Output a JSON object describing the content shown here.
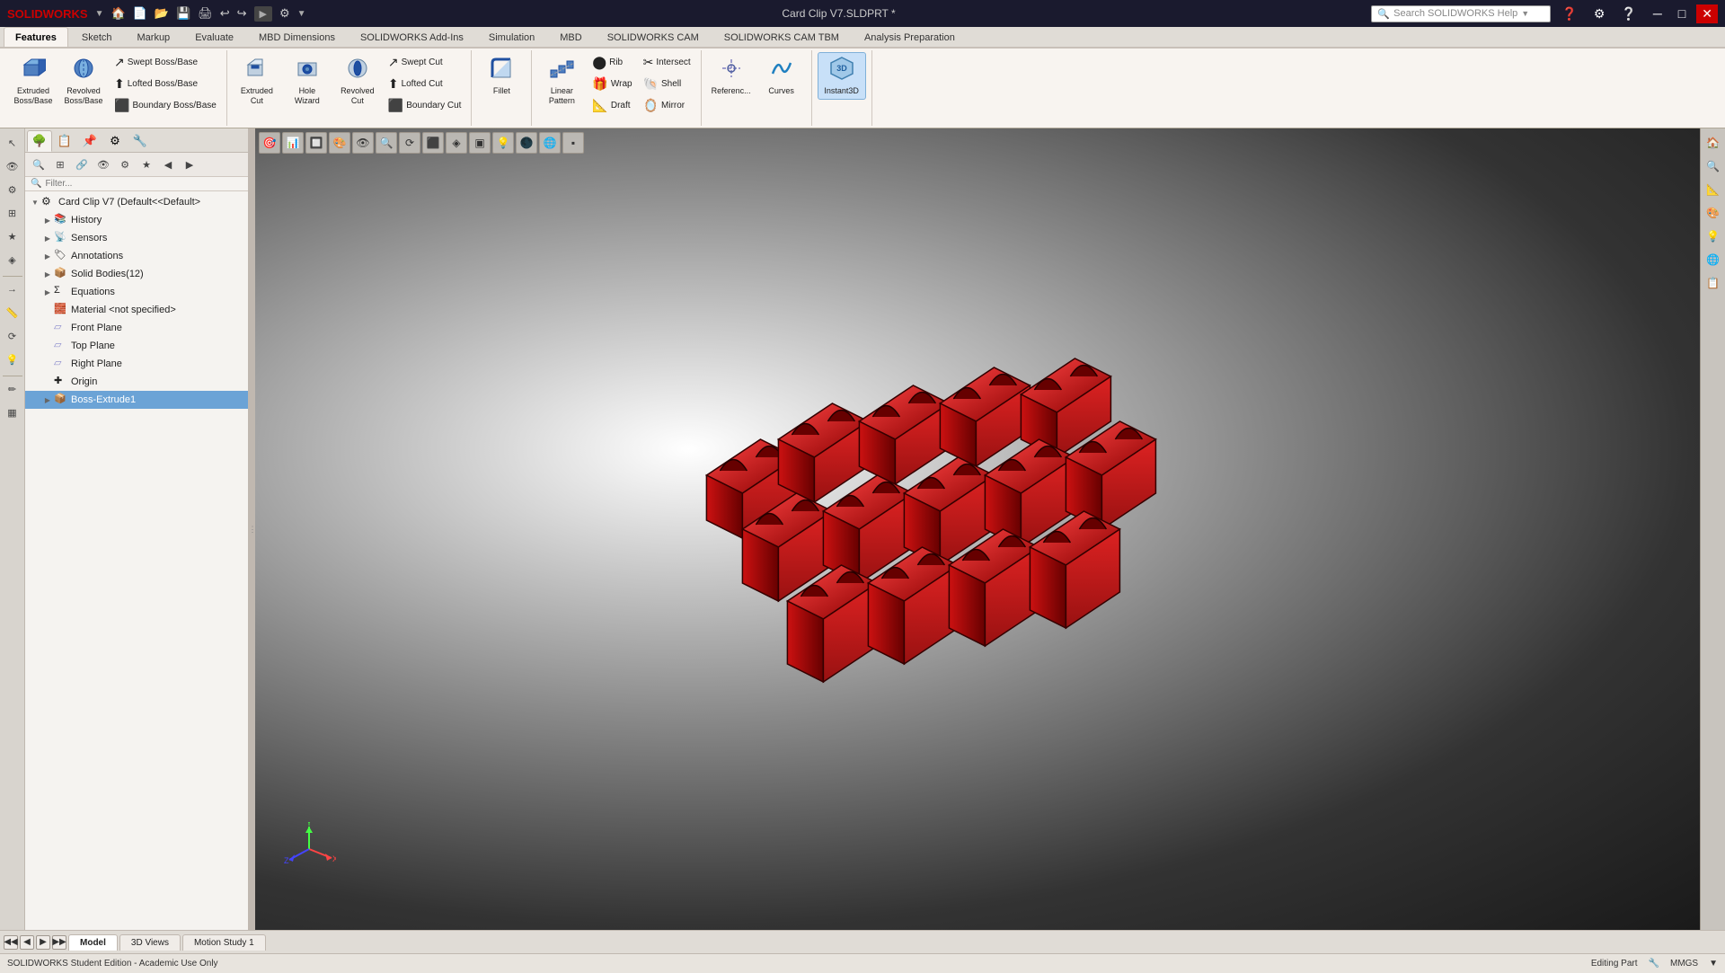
{
  "titlebar": {
    "logo": "SOLIDWORKS",
    "title": "Card Clip V7.SLDPRT *",
    "search_placeholder": "Search SOLIDWORKS Help",
    "min_btn": "─",
    "max_btn": "□",
    "close_btn": "✕"
  },
  "quick_access": {
    "buttons": [
      "🏠",
      "📄",
      "💾",
      "🖨",
      "↩",
      "↪",
      "▶",
      "⚙"
    ]
  },
  "ribbon": {
    "tabs": [
      "Features",
      "Sketch",
      "Markup",
      "Evaluate",
      "MBD Dimensions",
      "SOLIDWORKS Add-Ins",
      "Simulation",
      "MBD",
      "SOLIDWORKS CAM",
      "SOLIDWORKS CAM TBM",
      "Analysis Preparation"
    ],
    "active_tab": "Features",
    "groups": {
      "boss_base": {
        "label": "",
        "buttons_large": [
          {
            "icon": "📦",
            "label": "Extruded Boss/Base"
          },
          {
            "icon": "🔄",
            "label": "Revolved Boss/Base"
          }
        ],
        "buttons_small": [
          {
            "icon": "↗",
            "label": "Swept Boss/Base"
          },
          {
            "icon": "⬆",
            "label": "Lofted Boss/Base"
          },
          {
            "icon": "⬛",
            "label": "Boundary Boss/Base"
          }
        ]
      },
      "cut": {
        "label": "",
        "buttons_large": [
          {
            "icon": "✂",
            "label": "Extruded Cut"
          },
          {
            "icon": "🕳",
            "label": "Hole Wizard"
          },
          {
            "icon": "🔃",
            "label": "Revolved Cut"
          }
        ],
        "buttons_small": [
          {
            "icon": "↗",
            "label": "Swept Cut"
          },
          {
            "icon": "⬆",
            "label": "Lofted Cut"
          },
          {
            "icon": "⬛",
            "label": "Boundary Cut"
          }
        ]
      },
      "features": {
        "buttons_large": [
          {
            "icon": "◉",
            "label": "Fillet"
          },
          {
            "icon": "🔲",
            "label": "Linear Pattern"
          },
          {
            "icon": "⬡",
            "label": "Reference..."
          },
          {
            "icon": "〰",
            "label": "Curves"
          },
          {
            "icon": "⚡",
            "label": "Instant3D"
          }
        ],
        "buttons_small": [
          {
            "icon": "⬤",
            "label": "Rib"
          },
          {
            "icon": "🎁",
            "label": "Wrap"
          },
          {
            "icon": "📐",
            "label": "Draft"
          },
          {
            "icon": "✂",
            "label": "Intersect"
          },
          {
            "icon": "🐚",
            "label": "Shell"
          },
          {
            "icon": "🪞",
            "label": "Mirror"
          }
        ]
      }
    }
  },
  "feature_manager": {
    "tabs": [
      "🌳",
      "📋",
      "📌",
      "⚙",
      "🔧"
    ],
    "active_tab": 0,
    "filter_placeholder": "Filter...",
    "tree": [
      {
        "level": 0,
        "expand": true,
        "icon": "⚙",
        "label": "Card Clip V7  (Default<<Default>",
        "type": "part"
      },
      {
        "level": 1,
        "expand": true,
        "icon": "📚",
        "label": "History",
        "type": "history"
      },
      {
        "level": 1,
        "expand": false,
        "icon": "📡",
        "label": "Sensors",
        "type": "sensors"
      },
      {
        "level": 1,
        "expand": false,
        "icon": "🏷",
        "label": "Annotations",
        "type": "annotations"
      },
      {
        "level": 1,
        "expand": false,
        "icon": "📦",
        "label": "Solid Bodies(12)",
        "type": "solid-bodies"
      },
      {
        "level": 1,
        "expand": false,
        "icon": "📐",
        "label": "Equations",
        "type": "equations"
      },
      {
        "level": 1,
        "expand": false,
        "icon": "🧱",
        "label": "Material <not specified>",
        "type": "material"
      },
      {
        "level": 1,
        "expand": false,
        "icon": "📏",
        "label": "Front Plane",
        "type": "plane"
      },
      {
        "level": 1,
        "expand": false,
        "icon": "📏",
        "label": "Top Plane",
        "type": "plane"
      },
      {
        "level": 1,
        "expand": false,
        "icon": "📏",
        "label": "Right Plane",
        "type": "plane"
      },
      {
        "level": 1,
        "expand": false,
        "icon": "✚",
        "label": "Origin",
        "type": "origin"
      },
      {
        "level": 1,
        "expand": false,
        "icon": "📦",
        "label": "Boss-Extrude1",
        "type": "feature",
        "selected": true
      }
    ]
  },
  "viewport": {
    "toolbar_buttons": [
      "🎯",
      "📊",
      "🔲",
      "🎨",
      "🔵",
      "⬡",
      "▶",
      "◀",
      "🔷",
      "📐",
      "🔁",
      "⚙",
      "▪"
    ],
    "model_name": "Card Clip V7"
  },
  "bottom_tabs": {
    "tabs": [
      "Model",
      "3D Views",
      "Motion Study 1"
    ],
    "active_tab": "Model",
    "nav_buttons": [
      "◀◀",
      "◀",
      "▶",
      "▶▶"
    ]
  },
  "statusbar": {
    "left": "SOLIDWORKS Student Edition - Academic Use Only",
    "right_items": [
      "Editing Part",
      "",
      "MMGS",
      "▼"
    ]
  },
  "right_sidebar": {
    "buttons": [
      "🏠",
      "🔍",
      "📐",
      "🎨",
      "💡",
      "🌐",
      "📋"
    ]
  }
}
